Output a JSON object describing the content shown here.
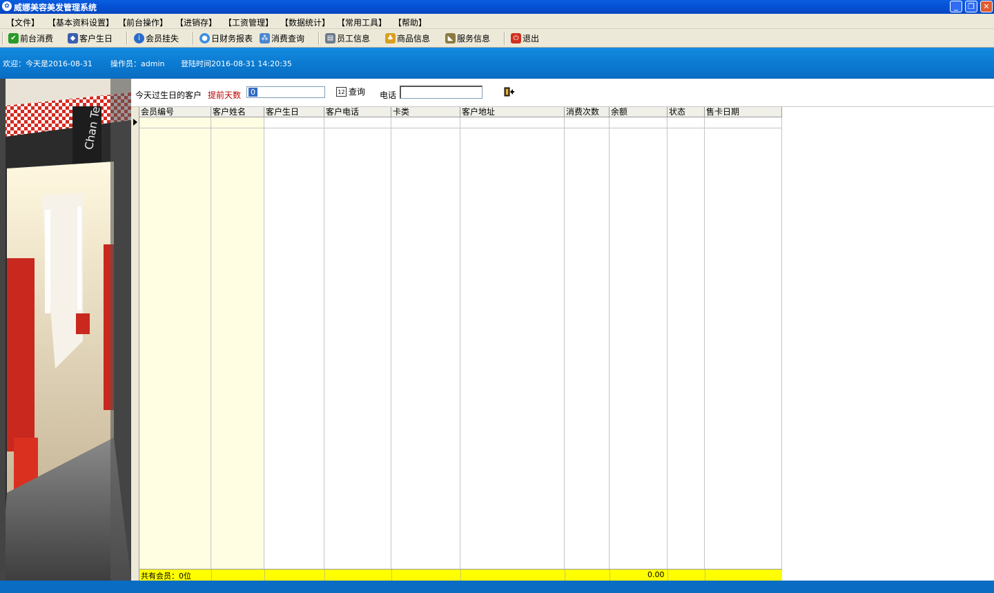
{
  "window": {
    "title": "威娜美容美发管理系统",
    "app_icon": "app-logo-icon",
    "controls": {
      "minimize": "_",
      "restore": "❐",
      "close": "✕"
    }
  },
  "menu": [
    "【文件】",
    "【基本资料设置】",
    "【前台操作】",
    "【进销存】",
    "【工资管理】",
    "【数据统计】",
    "【常用工具】",
    "【帮助】"
  ],
  "toolbar": [
    {
      "label": "前台消费",
      "icon": "checkmark-icon",
      "color": "#2a9a2a"
    },
    {
      "label": "客户生日",
      "icon": "cake-icon",
      "color": "#3a5fb0"
    },
    {
      "label": "会员挂失",
      "icon": "info-icon",
      "color": "#2a6cc9"
    },
    {
      "label": "日财务报表",
      "icon": "globe-icon",
      "color": "#3d8ee0"
    },
    {
      "label": "消费查询",
      "icon": "network-icon",
      "color": "#4a86d0"
    },
    {
      "label": "员工信息",
      "icon": "staff-card-icon",
      "color": "#6b7a8a"
    },
    {
      "label": "商品信息",
      "icon": "goods-icon",
      "color": "#d9a020"
    },
    {
      "label": "服务信息",
      "icon": "tag-icon",
      "color": "#8a7a40"
    },
    {
      "label": "退出",
      "icon": "power-icon",
      "color": "#d03020"
    }
  ],
  "status": {
    "welcome": "欢迎：今天是2016-08-31",
    "operator": "操作员：admin",
    "login_time": "登陆时间2016-08-31 14:20:35"
  },
  "search": {
    "birthday_label": "今天过生日的客户",
    "advance_days_label": "提前天数",
    "advance_days_value": "0",
    "query_label": "查询",
    "phone_label": "电话",
    "phone_value": ""
  },
  "grid": {
    "columns": [
      "会员编号",
      "客户姓名",
      "客户生日",
      "客户电话",
      "卡类",
      "客户地址",
      "消费次数",
      "余额",
      "状态",
      "售卡日期"
    ],
    "rows": [],
    "footer": {
      "total_label": "共有会员：0位",
      "balance_total": "0.00"
    }
  },
  "colors": {
    "title_bar": "#0552d6",
    "status_band": "#0a78cf",
    "highlight_col": "#fffde2",
    "footer": "#ffff00",
    "advance_label": "#c00000"
  }
}
